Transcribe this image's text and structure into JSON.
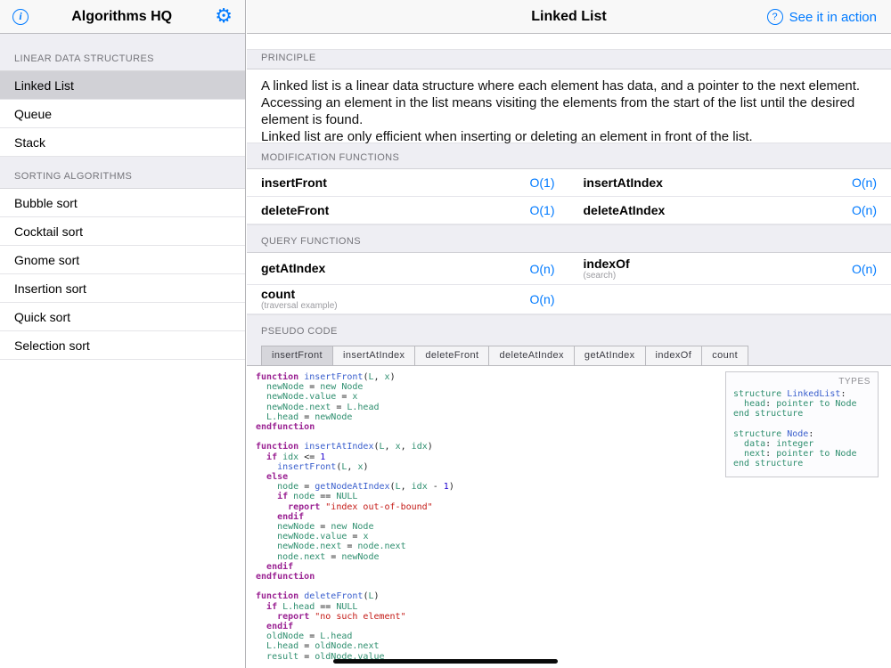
{
  "colors": {
    "accent": "#007aff"
  },
  "sidebar": {
    "title": "Algorithms HQ",
    "selected_item": "Linked List",
    "sections": [
      {
        "header": "LINEAR DATA STRUCTURES",
        "items": [
          "Linked List",
          "Queue",
          "Stack"
        ]
      },
      {
        "header": "SORTING ALGORITHMS",
        "items": [
          "Bubble sort",
          "Cocktail sort",
          "Gnome sort",
          "Insertion sort",
          "Quick sort",
          "Selection sort"
        ]
      }
    ]
  },
  "header": {
    "title": "Linked List",
    "help_icon": "?",
    "action_label": "See it in action"
  },
  "sections": {
    "principle": {
      "label": "PRINCIPLE",
      "paragraph1": "A linked list is a linear data structure where each element has data, and a pointer to the next element. Accessing an element in the list means visiting the elements from the start of the list until the desired element is found.",
      "paragraph2": "Linked list are only efficient when inserting or deleting an element in front of the list."
    },
    "modification": {
      "label": "MODIFICATION FUNCTIONS",
      "rows": [
        [
          {
            "name": "insertFront",
            "complexity": "O(1)"
          },
          {
            "name": "insertAtIndex",
            "complexity": "O(n)"
          }
        ],
        [
          {
            "name": "deleteFront",
            "complexity": "O(1)"
          },
          {
            "name": "deleteAtIndex",
            "complexity": "O(n)"
          }
        ]
      ]
    },
    "query": {
      "label": "QUERY FUNCTIONS",
      "rows": [
        [
          {
            "name": "getAtIndex",
            "complexity": "O(n)"
          },
          {
            "name": "indexOf",
            "note": "(search)",
            "complexity": "O(n)"
          }
        ],
        [
          {
            "name": "count",
            "note": "(traversal example)",
            "complexity": "O(n)"
          }
        ]
      ]
    },
    "pseudocode": {
      "label": "PSEUDO CODE",
      "selected_tab": "insertFront",
      "tabs": [
        "insertFront",
        "insertAtIndex",
        "deleteFront",
        "deleteAtIndex",
        "getAtIndex",
        "indexOf",
        "count"
      ],
      "code_lines": [
        [
          [
            "k",
            "function"
          ],
          [
            "p",
            " "
          ],
          [
            "f",
            "insertFront"
          ],
          [
            "p",
            "("
          ],
          [
            "v",
            "L"
          ],
          [
            "p",
            ", "
          ],
          [
            "v",
            "x"
          ],
          [
            "p",
            ")"
          ]
        ],
        [
          [
            "p",
            "  "
          ],
          [
            "v",
            "newNode"
          ],
          [
            "p",
            " = "
          ],
          [
            "v",
            "new Node"
          ]
        ],
        [
          [
            "p",
            "  "
          ],
          [
            "v",
            "newNode.value"
          ],
          [
            "p",
            " = "
          ],
          [
            "v",
            "x"
          ]
        ],
        [
          [
            "p",
            "  "
          ],
          [
            "v",
            "newNode.next"
          ],
          [
            "p",
            " = "
          ],
          [
            "v",
            "L.head"
          ]
        ],
        [
          [
            "p",
            "  "
          ],
          [
            "v",
            "L.head"
          ],
          [
            "p",
            " = "
          ],
          [
            "v",
            "newNode"
          ]
        ],
        [
          [
            "k",
            "endfunction"
          ]
        ],
        [],
        [
          [
            "k",
            "function"
          ],
          [
            "p",
            " "
          ],
          [
            "f",
            "insertAtIndex"
          ],
          [
            "p",
            "("
          ],
          [
            "v",
            "L"
          ],
          [
            "p",
            ", "
          ],
          [
            "v",
            "x"
          ],
          [
            "p",
            ", "
          ],
          [
            "v",
            "idx"
          ],
          [
            "p",
            ")"
          ]
        ],
        [
          [
            "p",
            "  "
          ],
          [
            "k",
            "if"
          ],
          [
            "p",
            " "
          ],
          [
            "v",
            "idx"
          ],
          [
            "p",
            " <= "
          ],
          [
            "n",
            "1"
          ]
        ],
        [
          [
            "p",
            "    "
          ],
          [
            "f",
            "insertFront"
          ],
          [
            "p",
            "("
          ],
          [
            "v",
            "L"
          ],
          [
            "p",
            ", "
          ],
          [
            "v",
            "x"
          ],
          [
            "p",
            ")"
          ]
        ],
        [
          [
            "p",
            "  "
          ],
          [
            "k",
            "else"
          ]
        ],
        [
          [
            "p",
            "    "
          ],
          [
            "v",
            "node"
          ],
          [
            "p",
            " = "
          ],
          [
            "f",
            "getNodeAtIndex"
          ],
          [
            "p",
            "("
          ],
          [
            "v",
            "L"
          ],
          [
            "p",
            ", "
          ],
          [
            "v",
            "idx"
          ],
          [
            "p",
            " - "
          ],
          [
            "n",
            "1"
          ],
          [
            "p",
            ")"
          ]
        ],
        [
          [
            "p",
            "    "
          ],
          [
            "k",
            "if"
          ],
          [
            "p",
            " "
          ],
          [
            "v",
            "node"
          ],
          [
            "p",
            " == "
          ],
          [
            "v",
            "NULL"
          ]
        ],
        [
          [
            "p",
            "      "
          ],
          [
            "k",
            "report"
          ],
          [
            "p",
            " "
          ],
          [
            "s",
            "\"index out-of-bound\""
          ]
        ],
        [
          [
            "p",
            "    "
          ],
          [
            "k",
            "endif"
          ]
        ],
        [
          [
            "p",
            "    "
          ],
          [
            "v",
            "newNode"
          ],
          [
            "p",
            " = "
          ],
          [
            "v",
            "new Node"
          ]
        ],
        [
          [
            "p",
            "    "
          ],
          [
            "v",
            "newNode.value"
          ],
          [
            "p",
            " = "
          ],
          [
            "v",
            "x"
          ]
        ],
        [
          [
            "p",
            "    "
          ],
          [
            "v",
            "newNode.next"
          ],
          [
            "p",
            " = "
          ],
          [
            "v",
            "node.next"
          ]
        ],
        [
          [
            "p",
            "    "
          ],
          [
            "v",
            "node.next"
          ],
          [
            "p",
            " = "
          ],
          [
            "v",
            "newNode"
          ]
        ],
        [
          [
            "p",
            "  "
          ],
          [
            "k",
            "endif"
          ]
        ],
        [
          [
            "k",
            "endfunction"
          ]
        ],
        [],
        [
          [
            "k",
            "function"
          ],
          [
            "p",
            " "
          ],
          [
            "f",
            "deleteFront"
          ],
          [
            "p",
            "("
          ],
          [
            "v",
            "L"
          ],
          [
            "p",
            ")"
          ]
        ],
        [
          [
            "p",
            "  "
          ],
          [
            "k",
            "if"
          ],
          [
            "p",
            " "
          ],
          [
            "v",
            "L.head"
          ],
          [
            "p",
            " == "
          ],
          [
            "v",
            "NULL"
          ]
        ],
        [
          [
            "p",
            "    "
          ],
          [
            "k",
            "report"
          ],
          [
            "p",
            " "
          ],
          [
            "s",
            "\"no such element\""
          ]
        ],
        [
          [
            "p",
            "  "
          ],
          [
            "k",
            "endif"
          ]
        ],
        [
          [
            "p",
            "  "
          ],
          [
            "v",
            "oldNode"
          ],
          [
            "p",
            " = "
          ],
          [
            "v",
            "L.head"
          ]
        ],
        [
          [
            "p",
            "  "
          ],
          [
            "v",
            "L.head"
          ],
          [
            "p",
            " = "
          ],
          [
            "v",
            "oldNode.next"
          ]
        ],
        [
          [
            "p",
            "  "
          ],
          [
            "v",
            "result"
          ],
          [
            "p",
            " = "
          ],
          [
            "v",
            "oldNode.value"
          ]
        ]
      ],
      "types_panel": {
        "label": "TYPES",
        "lines": [
          [
            [
              "v",
              "structure"
            ],
            [
              "p",
              " "
            ],
            [
              "f",
              "LinkedList"
            ],
            [
              "p",
              ":"
            ]
          ],
          [
            [
              "p",
              "  "
            ],
            [
              "v",
              "head"
            ],
            [
              "p",
              ": "
            ],
            [
              "v",
              "pointer to Node"
            ]
          ],
          [
            [
              "v",
              "end structure"
            ]
          ],
          [],
          [
            [
              "v",
              "structure"
            ],
            [
              "p",
              " "
            ],
            [
              "f",
              "Node"
            ],
            [
              "p",
              ":"
            ]
          ],
          [
            [
              "p",
              "  "
            ],
            [
              "v",
              "data"
            ],
            [
              "p",
              ": "
            ],
            [
              "v",
              "integer"
            ]
          ],
          [
            [
              "p",
              "  "
            ],
            [
              "v",
              "next"
            ],
            [
              "p",
              ": "
            ],
            [
              "v",
              "pointer to Node"
            ]
          ],
          [
            [
              "v",
              "end structure"
            ]
          ]
        ]
      }
    }
  }
}
